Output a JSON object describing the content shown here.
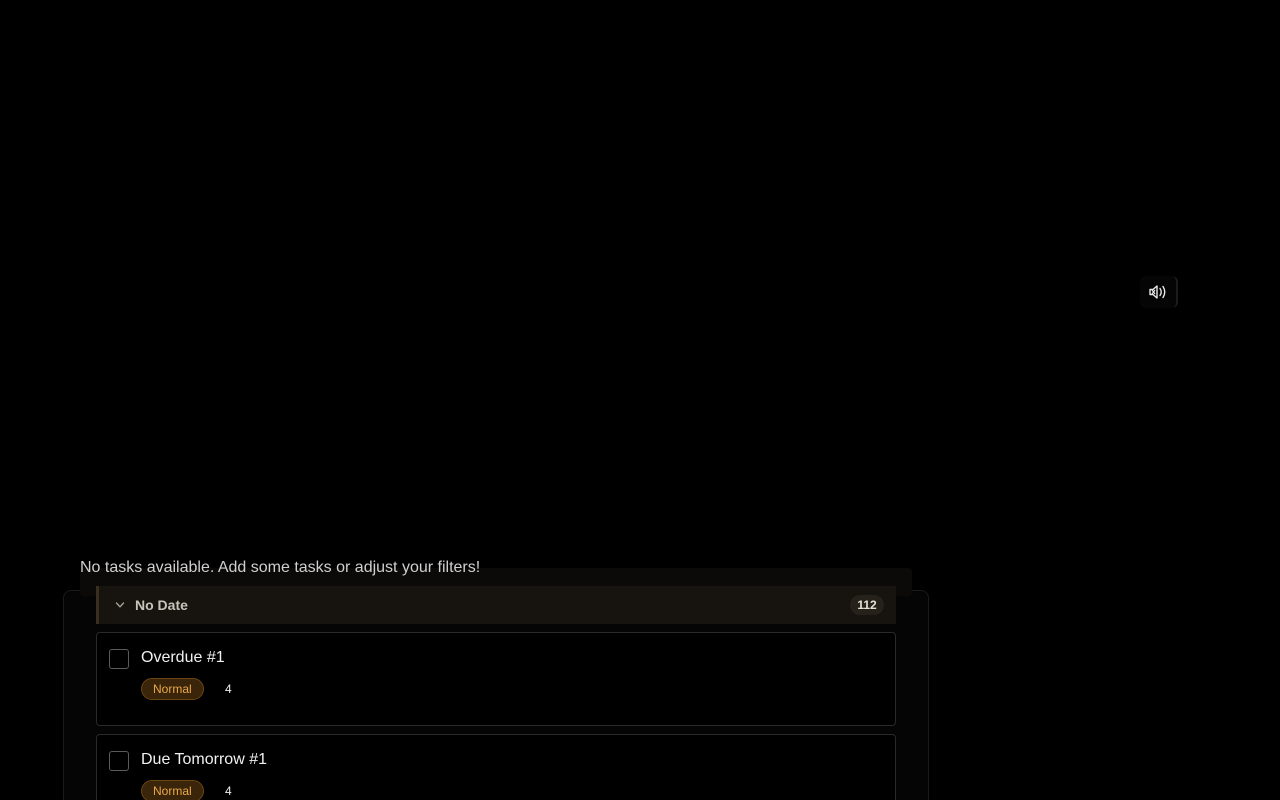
{
  "sound_toggle": {
    "icon": "speaker-muted-icon"
  },
  "empty_state": {
    "message": "No tasks available. Add some tasks or adjust your filters!"
  },
  "group": {
    "title": "No Date",
    "count": "112",
    "chevron_icon": "chevron-down-icon"
  },
  "tasks": [
    {
      "title": "Overdue #1",
      "priority": "Normal",
      "number": "4"
    },
    {
      "title": "Due Tomorrow #1",
      "priority": "Normal",
      "number": "4"
    }
  ],
  "colors": {
    "background": "#000000",
    "priority_text": "#e9a94a",
    "priority_bg": "#3a240a",
    "group_header_bg": "#17140f"
  }
}
